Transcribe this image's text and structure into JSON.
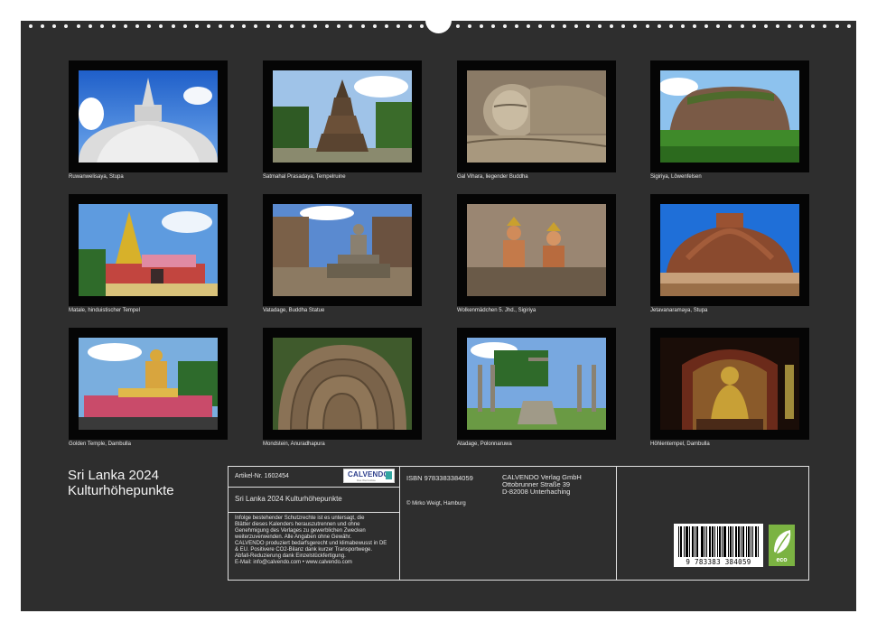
{
  "calendar": {
    "title_line1": "Sri Lanka 2024",
    "title_line2": "Kulturhöhepunkte"
  },
  "photos": [
    {
      "caption": "Ruwanwelisaya, Stupa",
      "scene": "stupa-dome"
    },
    {
      "caption": "Satmahal Prasadaya, Tempelruine",
      "scene": "temple-ruin"
    },
    {
      "caption": "Gal Vihara, liegender Buddha",
      "scene": "reclining-buddha"
    },
    {
      "caption": "Sigiriya, Löwenfelsen",
      "scene": "rock-fortress"
    },
    {
      "caption": "Matale, hinduistischer Tempel",
      "scene": "hindu-temple"
    },
    {
      "caption": "Vatadage, Buddha Statue",
      "scene": "buddha-statue"
    },
    {
      "caption": "Wolkenmädchen 5. Jhd., Sigiriya",
      "scene": "fresco"
    },
    {
      "caption": "Jetavanaramaya, Stupa",
      "scene": "brick-stupa"
    },
    {
      "caption": "Golden Temple, Dambulla",
      "scene": "golden-temple"
    },
    {
      "caption": "Mondstein, Anuradhapura",
      "scene": "moonstone"
    },
    {
      "caption": "Atadage, Polonnaruwa",
      "scene": "pillar-ruins"
    },
    {
      "caption": "Höhlentempel, Dambulla",
      "scene": "cave-temple"
    }
  ],
  "info": {
    "article_label": "Artikel-Nr. 1602454",
    "calendar_name": "Sri Lanka 2024 Kulturhöhepunkte",
    "legal_text": [
      "Infolge bestehender Schutzrechte ist es untersagt, die",
      "Blätter dieses Kalenders herauszutrennen und ohne",
      "Genehmigung des Verlages zu gewerblichen Zwecken",
      "weiterzuverwenden. Alle Angaben ohne Gewähr.",
      "CALVENDO produziert bedarfsgerecht und klimabewusst in DE",
      "& EU. Positivere CO2-Bilanz dank kurzer Transportwege.",
      "Abfall-Reduzierung dank Einzelstückfertigung.",
      "E-Mail: info@calvendo.com • www.calvendo.com"
    ],
    "isbn": "ISBN 9783383384059",
    "copyright": "© Mirko Weigt, Hamburg",
    "publisher": [
      "CALVENDO Verlag GmbH",
      "Ottobrunner Straße 39",
      "D-82008 Unterhaching"
    ],
    "logo_text": "CALVENDO",
    "logo_sub": "Das Wertvollste",
    "barcode_number": "9 783383 384059",
    "eco_label": "eco"
  }
}
